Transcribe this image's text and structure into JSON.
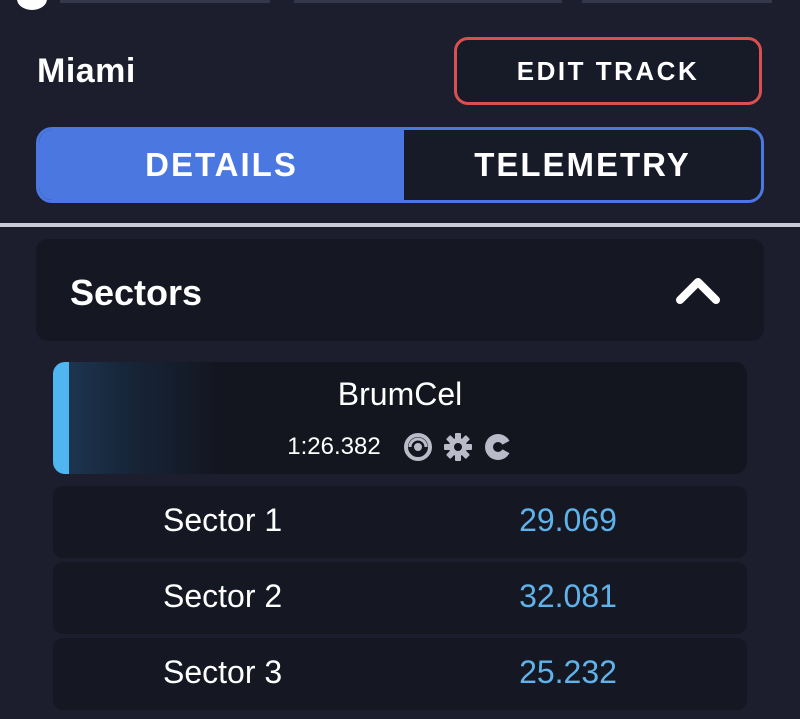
{
  "track": {
    "name": "Miami"
  },
  "actions": {
    "edit_track_label": "EDIT TRACK"
  },
  "tabs": [
    {
      "label": "DETAILS",
      "active": true
    },
    {
      "label": "TELEMETRY",
      "active": false
    }
  ],
  "sectors_panel": {
    "title": "Sectors",
    "expanded": true,
    "toggle_icon": "chevron-up-icon"
  },
  "lap": {
    "driver": "BrumCel",
    "time": "1:26.382",
    "icons": [
      "tyre-icon",
      "gear-icon",
      "steering-assist-icon"
    ]
  },
  "sectors": [
    {
      "label": "Sector 1",
      "time": "29.069"
    },
    {
      "label": "Sector 2",
      "time": "32.081"
    },
    {
      "label": "Sector 3",
      "time": "25.232"
    }
  ],
  "colors": {
    "background": "#1c1e2d",
    "accent_blue": "#4b78e0",
    "edit_border_red": "#d9514f",
    "sector_time_blue": "#5fb3ea",
    "lap_accent_cyan": "#4fb6f0"
  }
}
